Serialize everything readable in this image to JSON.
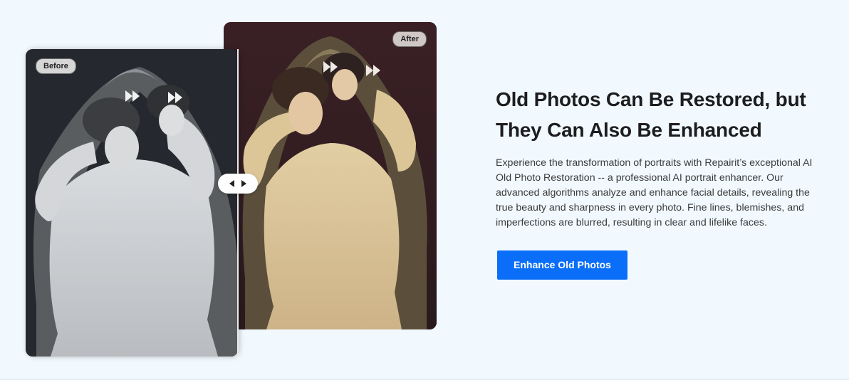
{
  "comparison": {
    "before_label": "Before",
    "after_label": "After",
    "handle_icons": [
      "arrow-left-icon",
      "arrow-right-icon"
    ],
    "colors": {
      "before_tone": "#c9cbcf",
      "after_tone": "#d7c29a",
      "after_background": "#3a2025"
    }
  },
  "content": {
    "headline": "Old Photos Can Be Restored, but They Can Also Be Enhanced",
    "description": "Experience the transformation of portraits with Repairit’s exceptional AI Old Photo Restoration -- a professional AI portrait enhancer. Our advanced algorithms analyze and enhance facial details, revealing the true beauty and sharpness in every photo. Fine lines, blemishes, and imperfections are blurred, resulting in clear and lifelike faces.",
    "cta_label": "Enhance Old Photos"
  },
  "colors": {
    "page_background": "#f1f9fe",
    "accent": "#0a6ef8",
    "heading": "#1d1d1f"
  }
}
